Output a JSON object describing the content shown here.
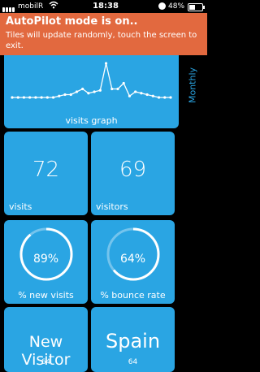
{
  "status": {
    "carrier": "mobilR",
    "time": "18:38",
    "battery_pct": "48%",
    "battery_level": 0.48
  },
  "banner": {
    "title": "AutoPilot mode is on..",
    "message": "Tiles will update randomly, touch the screen to exit."
  },
  "graph": {
    "label": "visits graph",
    "points": [
      6,
      6,
      6,
      6,
      6,
      6,
      6,
      6,
      7,
      8,
      8,
      10,
      12,
      9,
      10,
      11,
      30,
      12,
      12,
      16,
      7,
      10,
      9,
      8,
      7,
      6,
      6,
      6
    ]
  },
  "period": {
    "label": "Monthly"
  },
  "visits": {
    "value": "72",
    "label": "visits"
  },
  "visitors": {
    "value": "69",
    "label": "visitors"
  },
  "new_visits": {
    "value": "89%",
    "fraction": 0.89,
    "label": "% new visits"
  },
  "bounce_rate": {
    "value": "64%",
    "fraction": 0.64,
    "label": "% bounce rate"
  },
  "visitor_type": {
    "value": "New Visitor",
    "count": "64"
  },
  "country": {
    "value": "Spain",
    "count": "64"
  },
  "colors": {
    "tile": "#2aa5e3",
    "banner": "#e2693f",
    "background": "#000000"
  }
}
